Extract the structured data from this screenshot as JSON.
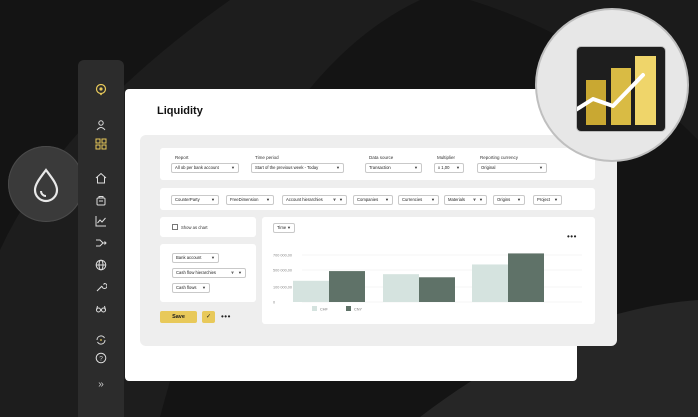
{
  "page": {
    "title": "Liquidity"
  },
  "colors": {
    "accent": "#e8c95a",
    "bar_light": "#d5e3df",
    "bar_dark": "#5f7268",
    "sidebar": "#2c2c2c"
  },
  "sidebar": {
    "icons": [
      "location-pin-icon",
      "user-icon",
      "grid-icon",
      "home-icon",
      "bank-icon",
      "analytics-icon",
      "split-arrows-icon",
      "globe-icon",
      "wrench-icon",
      "glasses-icon",
      "sync-icon",
      "help-icon"
    ],
    "expand_glyph": "»"
  },
  "filters": {
    "report": {
      "label": "Report",
      "value": "All ob per bank account"
    },
    "time_period": {
      "label": "Time period",
      "value": "Start of the previous week - Today"
    },
    "data_source": {
      "label": "Data source",
      "value": "Transaction"
    },
    "multiplier": {
      "label": "Multiplier",
      "value": "x 1,00"
    },
    "reporting_currency": {
      "label": "Reporting currency",
      "value": "Original"
    }
  },
  "dimension_chips": [
    "CounterParty",
    "FreeDimension",
    "Account hierarchies",
    "Companies",
    "Currencies",
    "Materials",
    "Origins",
    "Project"
  ],
  "options": {
    "show_as_chart": "Show as chart"
  },
  "grouping": [
    "Bank account",
    "Cash flow hierarchies",
    "Cash flows"
  ],
  "actions": {
    "save_label": "Save",
    "check_glyph": "✓",
    "more_glyph": "•••"
  },
  "chart_controls": {
    "axis_select": "Time"
  },
  "chart_data": {
    "type": "bar",
    "categories": [
      "",
      "",
      ""
    ],
    "series": [
      {
        "name": "CHF",
        "values": [
          480000,
          630000,
          850000
        ]
      },
      {
        "name": "CNY",
        "values": [
          700000,
          560000,
          1100000
        ]
      }
    ],
    "y_ticks": [
      "700 000,00",
      "500 000,00",
      "100 000,00",
      "0"
    ],
    "ylim": [
      0,
      1200000
    ],
    "legend": "bottom-left"
  }
}
